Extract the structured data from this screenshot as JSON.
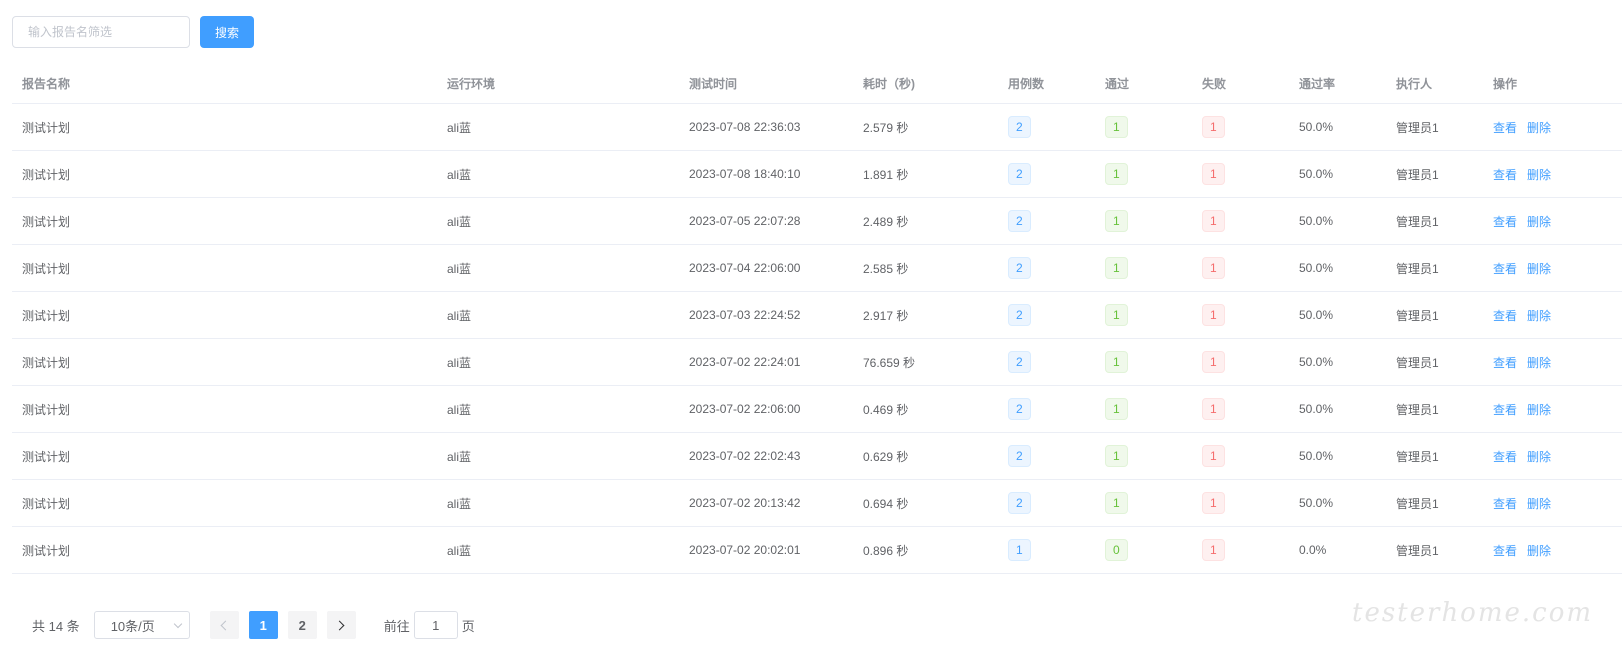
{
  "search": {
    "placeholder": "输入报告名筛选",
    "value": "",
    "button_label": "搜索"
  },
  "table": {
    "columns": [
      "报告名称",
      "运行环境",
      "测试时间",
      "耗时（秒)",
      "用例数",
      "通过",
      "失败",
      "通过率",
      "执行人",
      "操作"
    ],
    "view_label": "查看",
    "delete_label": "删除",
    "rows": [
      {
        "name": "测试计划",
        "env": "ali蓝",
        "time": "2023-07-08 22:36:03",
        "duration": "2.579 秒",
        "cases": "2",
        "passed": "1",
        "failed": "1",
        "rate": "50.0%",
        "executor": "管理员1"
      },
      {
        "name": "测试计划",
        "env": "ali蓝",
        "time": "2023-07-08 18:40:10",
        "duration": "1.891 秒",
        "cases": "2",
        "passed": "1",
        "failed": "1",
        "rate": "50.0%",
        "executor": "管理员1"
      },
      {
        "name": "测试计划",
        "env": "ali蓝",
        "time": "2023-07-05 22:07:28",
        "duration": "2.489 秒",
        "cases": "2",
        "passed": "1",
        "failed": "1",
        "rate": "50.0%",
        "executor": "管理员1"
      },
      {
        "name": "测试计划",
        "env": "ali蓝",
        "time": "2023-07-04 22:06:00",
        "duration": "2.585 秒",
        "cases": "2",
        "passed": "1",
        "failed": "1",
        "rate": "50.0%",
        "executor": "管理员1"
      },
      {
        "name": "测试计划",
        "env": "ali蓝",
        "time": "2023-07-03 22:24:52",
        "duration": "2.917 秒",
        "cases": "2",
        "passed": "1",
        "failed": "1",
        "rate": "50.0%",
        "executor": "管理员1"
      },
      {
        "name": "测试计划",
        "env": "ali蓝",
        "time": "2023-07-02 22:24:01",
        "duration": "76.659 秒",
        "cases": "2",
        "passed": "1",
        "failed": "1",
        "rate": "50.0%",
        "executor": "管理员1"
      },
      {
        "name": "测试计划",
        "env": "ali蓝",
        "time": "2023-07-02 22:06:00",
        "duration": "0.469 秒",
        "cases": "2",
        "passed": "1",
        "failed": "1",
        "rate": "50.0%",
        "executor": "管理员1"
      },
      {
        "name": "测试计划",
        "env": "ali蓝",
        "time": "2023-07-02 22:02:43",
        "duration": "0.629 秒",
        "cases": "2",
        "passed": "1",
        "failed": "1",
        "rate": "50.0%",
        "executor": "管理员1"
      },
      {
        "name": "测试计划",
        "env": "ali蓝",
        "time": "2023-07-02 20:13:42",
        "duration": "0.694 秒",
        "cases": "2",
        "passed": "1",
        "failed": "1",
        "rate": "50.0%",
        "executor": "管理员1"
      },
      {
        "name": "测试计划",
        "env": "ali蓝",
        "time": "2023-07-02 20:02:01",
        "duration": "0.896 秒",
        "cases": "1",
        "passed": "0",
        "failed": "1",
        "rate": "0.0%",
        "executor": "管理员1"
      }
    ]
  },
  "pagination": {
    "total_label": "共 14 条",
    "page_size_label": "10条/页",
    "pages": [
      "1",
      "2"
    ],
    "current_page": "1",
    "goto_prefix": "前往",
    "goto_value": "1",
    "goto_suffix": "页"
  },
  "watermark": "testerhome.com",
  "colors": {
    "primary": "#409eff",
    "success": "#67c23a",
    "danger": "#f56c6c"
  },
  "icons": {
    "prev": "chevron-left-icon",
    "next": "chevron-right-icon",
    "select": "chevron-down-icon"
  }
}
